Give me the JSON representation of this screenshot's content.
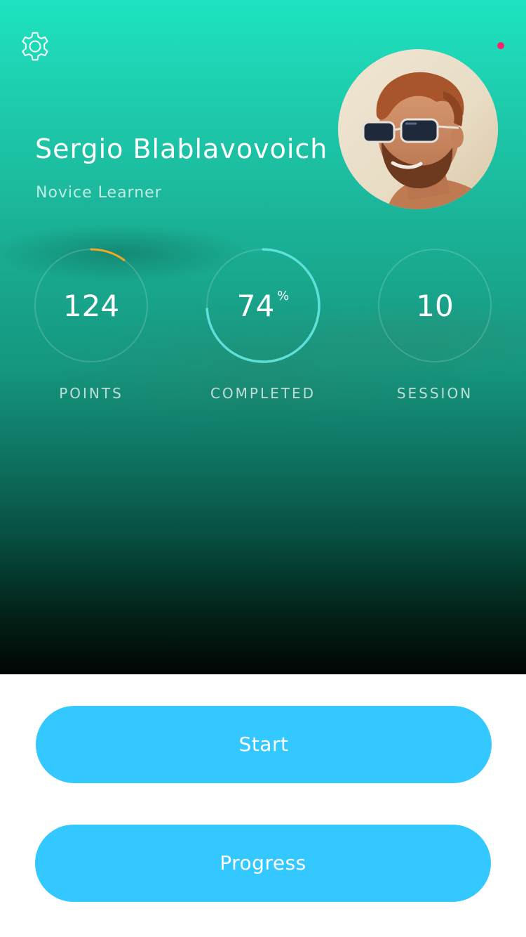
{
  "profile": {
    "name": "Sergio Blablavovoich",
    "level": "Novice Learner",
    "avatar_icon": "user-avatar-photo"
  },
  "header": {
    "settings_icon": "gear-icon",
    "notification_color": "#ff1f6b"
  },
  "stats": {
    "points": {
      "value": "124",
      "label": "POINTS",
      "progress_fraction": 0.1,
      "ring_color": "#f5a623"
    },
    "completed": {
      "value": "74",
      "unit": "%",
      "label": "COMPLETED",
      "progress_fraction": 0.74,
      "ring_color": "#5ee0d8"
    },
    "session": {
      "value": "10",
      "label": "SESSION",
      "progress_fraction": 0
    }
  },
  "actions": {
    "start_label": "Start",
    "progress_label": "Progress",
    "button_color": "#33c8ff"
  }
}
